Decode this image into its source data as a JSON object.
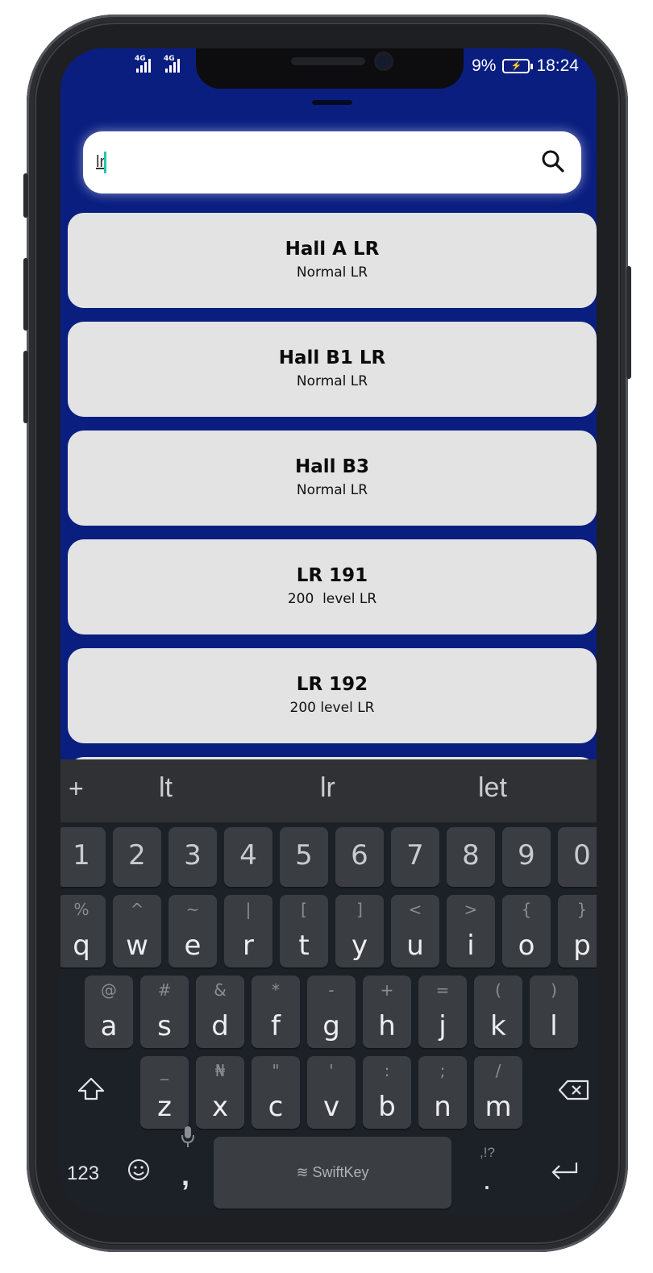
{
  "status": {
    "net1": "4G",
    "net2": "4G",
    "battery_text": "9%",
    "time": "18:24"
  },
  "search": {
    "value": "lr",
    "placeholder": ""
  },
  "results": [
    {
      "title": "Hall A LR",
      "subtitle": "Normal LR"
    },
    {
      "title": "Hall B1 LR",
      "subtitle": "Normal LR"
    },
    {
      "title": "Hall B3",
      "subtitle": "Normal LR"
    },
    {
      "title": "LR 191",
      "subtitle": "200  level LR"
    },
    {
      "title": "LR 192",
      "subtitle": "200 level LR"
    }
  ],
  "keyboard": {
    "suggest_plus": "+",
    "suggestions": [
      "lt",
      "lr",
      "let"
    ],
    "numbers": [
      "1",
      "2",
      "3",
      "4",
      "5",
      "6",
      "7",
      "8",
      "9",
      "0"
    ],
    "row1": [
      {
        "main": "q",
        "alt": "%"
      },
      {
        "main": "w",
        "alt": "^"
      },
      {
        "main": "e",
        "alt": "~"
      },
      {
        "main": "r",
        "alt": "|"
      },
      {
        "main": "t",
        "alt": "["
      },
      {
        "main": "y",
        "alt": "]"
      },
      {
        "main": "u",
        "alt": "<"
      },
      {
        "main": "i",
        "alt": ">"
      },
      {
        "main": "o",
        "alt": "{"
      },
      {
        "main": "p",
        "alt": "}"
      }
    ],
    "row2": [
      {
        "main": "a",
        "alt": "@"
      },
      {
        "main": "s",
        "alt": "#"
      },
      {
        "main": "d",
        "alt": "&"
      },
      {
        "main": "f",
        "alt": "*"
      },
      {
        "main": "g",
        "alt": "-"
      },
      {
        "main": "h",
        "alt": "+"
      },
      {
        "main": "j",
        "alt": "="
      },
      {
        "main": "k",
        "alt": "("
      },
      {
        "main": "l",
        "alt": ")"
      }
    ],
    "row3": [
      {
        "main": "z",
        "alt": "_"
      },
      {
        "main": "x",
        "alt": "₦"
      },
      {
        "main": "c",
        "alt": "\""
      },
      {
        "main": "v",
        "alt": "'"
      },
      {
        "main": "b",
        "alt": ":"
      },
      {
        "main": "n",
        "alt": ";"
      },
      {
        "main": "m",
        "alt": "/"
      }
    ],
    "num_mode_label": "123",
    "comma": ",",
    "space_label": "SwiftKey",
    "period": ".",
    "period_alt": ",!?"
  }
}
